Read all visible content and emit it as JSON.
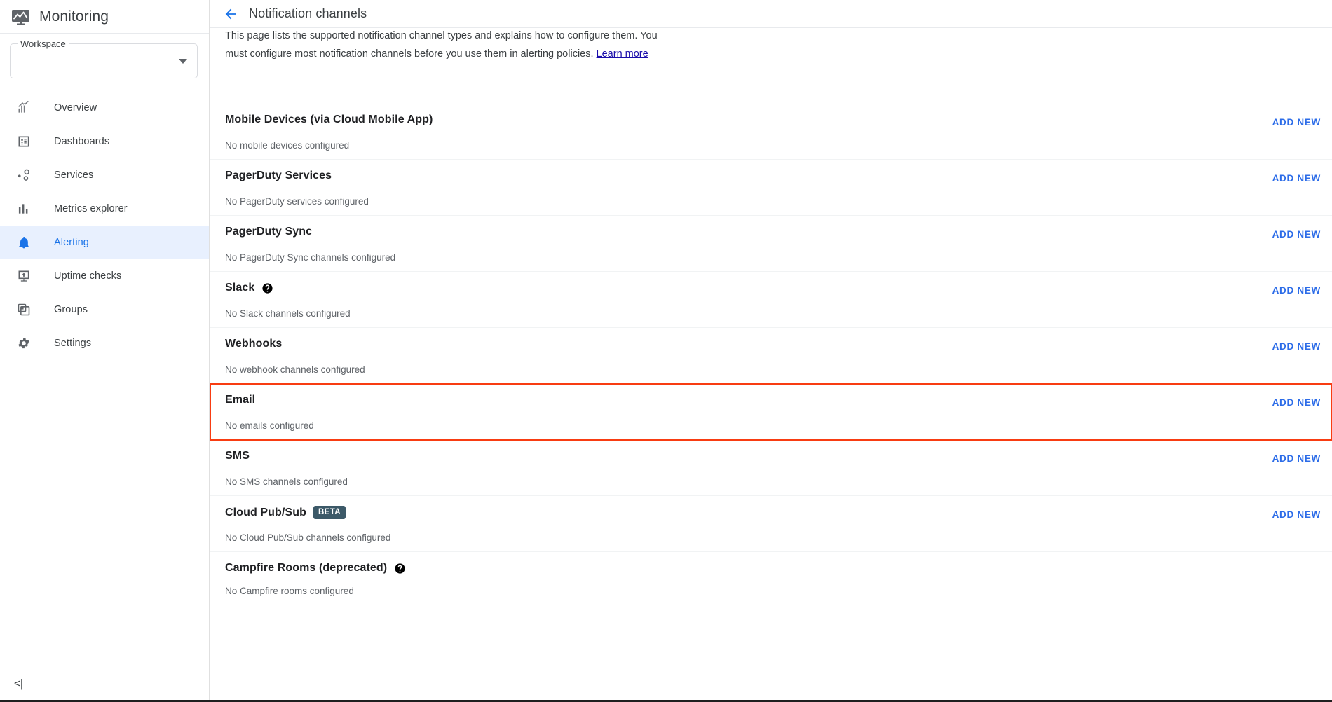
{
  "app": {
    "brand_title": "Monitoring",
    "brand_icon": "monitoring-chart-icon"
  },
  "sidebar": {
    "workspace": {
      "label": "Workspace",
      "value": "",
      "placeholder": ""
    },
    "items": [
      {
        "label": "Overview",
        "icon": "chart-trend-icon",
        "active": false
      },
      {
        "label": "Dashboards",
        "icon": "dashboard-grid-icon",
        "active": false
      },
      {
        "label": "Services",
        "icon": "services-node-icon",
        "active": false
      },
      {
        "label": "Metrics explorer",
        "icon": "bar-chart-icon",
        "active": false
      },
      {
        "label": "Alerting",
        "icon": "bell-icon",
        "active": true
      },
      {
        "label": "Uptime checks",
        "icon": "uptime-monitor-icon",
        "active": false
      },
      {
        "label": "Groups",
        "icon": "groups-layers-icon",
        "active": false
      },
      {
        "label": "Settings",
        "icon": "gear-icon",
        "active": false
      }
    ],
    "collapse_label": "<|"
  },
  "header": {
    "back_label": "back-arrow",
    "title": "Notification channels"
  },
  "intro": {
    "text": "This page lists the supported notification channel types and explains how to configure them. You must configure most notification channels before you use them in alerting policies. ",
    "link_text": "Learn more"
  },
  "add_new_label": "ADD NEW",
  "channels": [
    {
      "title": "Mobile Devices (via Cloud Mobile App)",
      "status": "No mobile devices configured",
      "badge": null,
      "help": false,
      "highlighted": false
    },
    {
      "title": "PagerDuty Services",
      "status": "No PagerDuty services configured",
      "badge": null,
      "help": false,
      "highlighted": false
    },
    {
      "title": "PagerDuty Sync",
      "status": "No PagerDuty Sync channels configured",
      "badge": null,
      "help": false,
      "highlighted": false
    },
    {
      "title": "Slack",
      "status": "No Slack channels configured",
      "badge": null,
      "help": true,
      "highlighted": false
    },
    {
      "title": "Webhooks",
      "status": "No webhook channels configured",
      "badge": null,
      "help": false,
      "highlighted": false
    },
    {
      "title": "Email",
      "status": "No emails configured",
      "badge": null,
      "help": false,
      "highlighted": true
    },
    {
      "title": "SMS",
      "status": "No SMS channels configured",
      "badge": null,
      "help": false,
      "highlighted": false
    },
    {
      "title": "Cloud Pub/Sub",
      "status": "No Cloud Pub/Sub channels configured",
      "badge": "BETA",
      "help": false,
      "highlighted": false
    },
    {
      "title": "Campfire Rooms (deprecated)",
      "status": "No Campfire rooms configured",
      "badge": null,
      "help": true,
      "highlighted": false
    }
  ],
  "colors": {
    "accent_blue": "#1a73e8",
    "link_blue": "#2c6ce8",
    "highlight_red": "#f83c12",
    "active_nav_bg": "#e8f0fe",
    "beta_badge_bg": "#3c5968",
    "text_primary": "#202124",
    "text_secondary": "#5f6368"
  }
}
